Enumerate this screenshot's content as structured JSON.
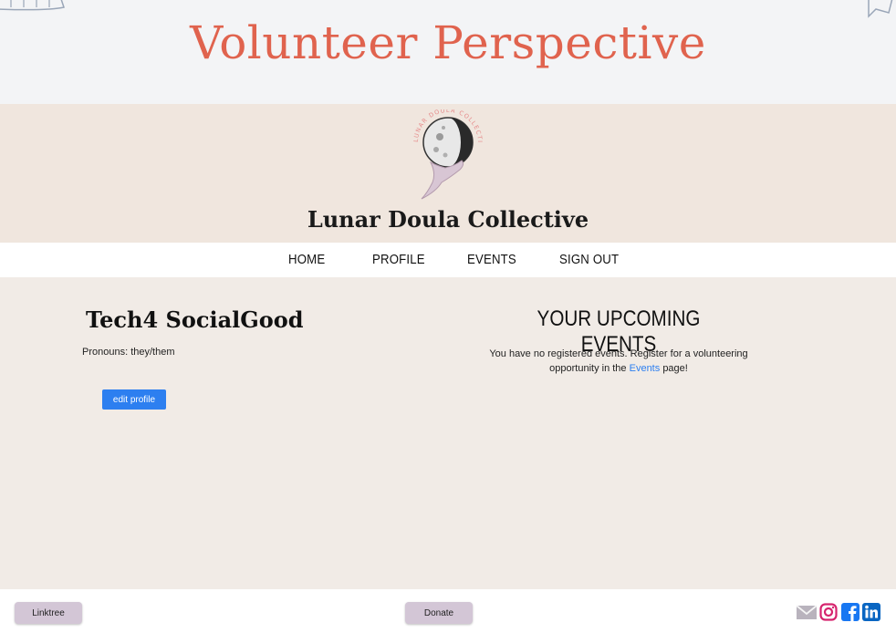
{
  "banner": {
    "title": "Volunteer Perspective"
  },
  "site": {
    "name": "Lunar Doula Collective",
    "logo_text": "LUNAR DOULA COLLECTIVE"
  },
  "nav": {
    "items": [
      "HOME",
      "PROFILE",
      "EVENTS",
      "SIGN OUT"
    ]
  },
  "profile": {
    "name": "Tech4 SocialGood",
    "pronouns": "Pronouns: they/them",
    "edit_label": "edit profile"
  },
  "events": {
    "heading": "YOUR UPCOMING EVENTS",
    "message_pre": "You have no registered events. Register for a volunteering opportunity in the",
    "link_text": "Events",
    "message_post": "page!"
  },
  "footer": {
    "linktree_label": "Linktree",
    "donate_label": "Donate",
    "social_icons": [
      "mail-icon",
      "instagram-icon",
      "facebook-icon",
      "linkedin-icon"
    ]
  },
  "colors": {
    "title": "#e0634e",
    "header_bg": "#f0e6de",
    "content_bg": "#f1ebe6",
    "button_blue": "#2d7ff0",
    "footer_button": "#d3c6d6"
  }
}
